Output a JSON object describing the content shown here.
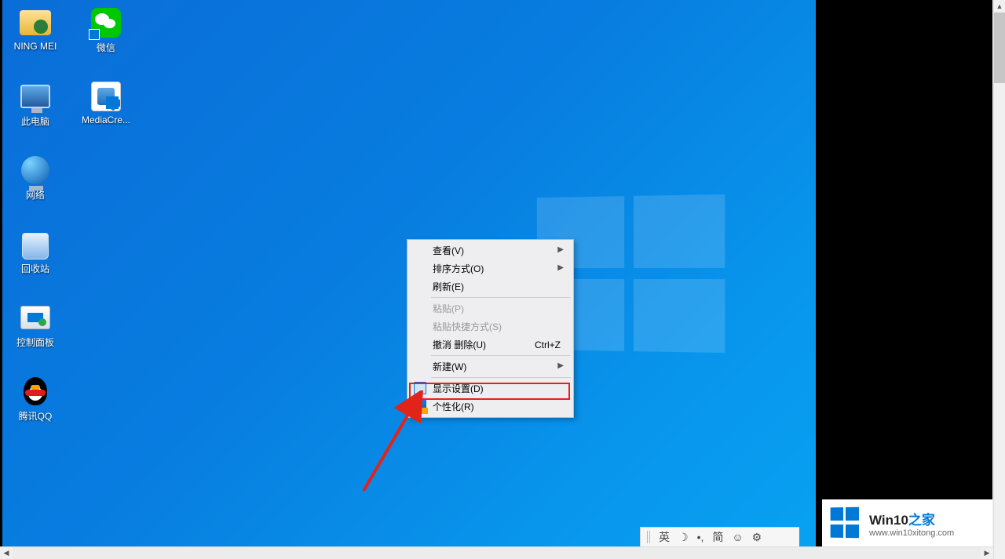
{
  "desktop_icons": {
    "user_folder": "NING MEI",
    "wechat": "微信",
    "this_pc": "此电脑",
    "media_tool": "MediaCre...",
    "network": "网络",
    "recycle_bin": "回收站",
    "control_panel": "控制面板",
    "qq": "腾讯QQ"
  },
  "context_menu": {
    "view": "查看(V)",
    "sort": "排序方式(O)",
    "refresh": "刷新(E)",
    "paste": "粘贴(P)",
    "paste_shortcut": "粘贴快捷方式(S)",
    "undo_delete": "撤消 删除(U)",
    "undo_shortcut": "Ctrl+Z",
    "new": "新建(W)",
    "display_settings": "显示设置(D)",
    "personalize": "个性化(R)"
  },
  "ime": {
    "lang": "英",
    "mode": "简"
  },
  "watermark": {
    "brand_prefix": "Win10",
    "brand_suffix": "之家",
    "url": "www.win10xitong.com"
  }
}
